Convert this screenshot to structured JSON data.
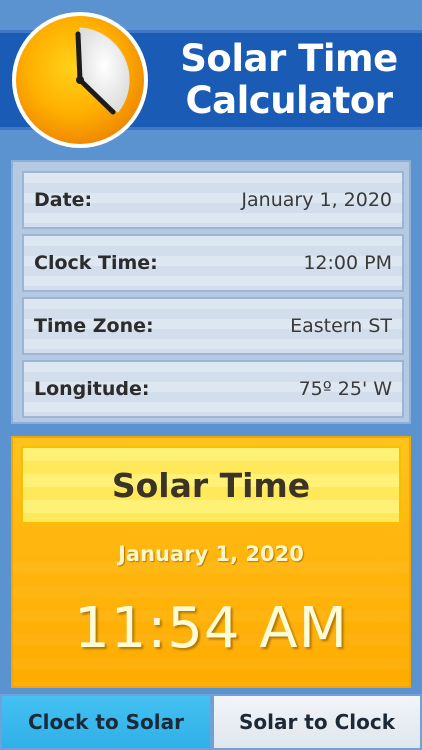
{
  "header": {
    "title_line1": "Solar Time",
    "title_line2": "Calculator"
  },
  "info": {
    "rows": [
      {
        "label": "Date:",
        "value": "January 1, 2020"
      },
      {
        "label": "Clock Time:",
        "value": "12:00 PM"
      },
      {
        "label": "Time Zone:",
        "value": "Eastern ST"
      },
      {
        "label": "Longitude:",
        "value": "75º 25' W"
      }
    ]
  },
  "result": {
    "title": "Solar Time",
    "date": "January 1, 2020",
    "time": "11:54 AM"
  },
  "tabs": {
    "clock_to_solar": "Clock to Solar",
    "solar_to_clock": "Solar to Clock",
    "active": "clock_to_solar"
  },
  "icons": {
    "logo": "clock-icon"
  },
  "colors": {
    "header_band": "#1a5bb5",
    "background": "#5b93d1",
    "result_orange": "#ffb70f",
    "active_tab": "#2fb0e8"
  }
}
